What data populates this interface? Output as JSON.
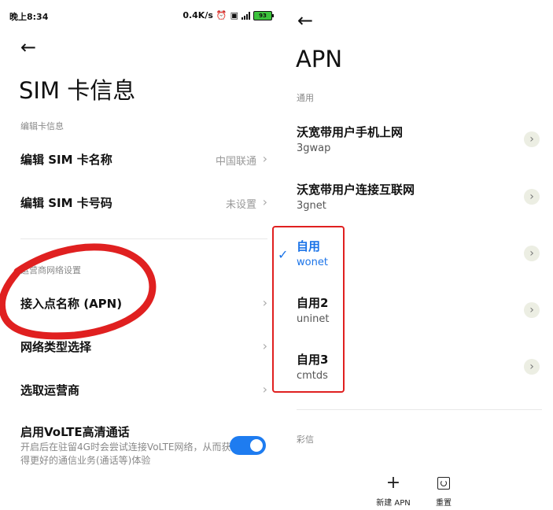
{
  "status_bar": {
    "time": "晚上8:34",
    "net_speed": "0.4K/s",
    "battery": "93"
  },
  "sim_info": {
    "title": "SIM 卡信息",
    "section_edit": "编辑卡信息",
    "edit_name_label": "编辑 SIM 卡名称",
    "edit_name_value": "中国联通",
    "edit_number_label": "编辑 SIM 卡号码",
    "edit_number_value": "未设置",
    "section_carrier": "运营商网络设置",
    "apn_label": "接入点名称 (APN)",
    "network_type_label": "网络类型选择",
    "carrier_select_label": "选取运营商",
    "volte_title": "启用VoLTE高清通话",
    "volte_desc": "开启后在驻留4G时会尝试连接VoLTE网络，从而获得更好的通信业务(通话等)体验",
    "volte_enabled": true
  },
  "apn": {
    "title": "APN",
    "section_general": "通用",
    "items": [
      {
        "name": "沃宽带用户手机上网",
        "type": "3gwap",
        "selected": false
      },
      {
        "name": "沃宽带用户连接互联网",
        "type": "3gnet",
        "selected": false
      },
      {
        "name": "自用",
        "type": "wonet",
        "selected": true
      },
      {
        "name": "自用2",
        "type": "uninet",
        "selected": false
      },
      {
        "name": "自用3",
        "type": "cmtds",
        "selected": false
      }
    ],
    "section_mms": "彩信",
    "new_apn_label": "新建 APN",
    "reset_label": "重置"
  },
  "icons": {
    "back": "arrow-left-icon",
    "chevron": "chevron-right-icon",
    "check": "check-icon",
    "add": "plus-icon",
    "reset": "reset-icon"
  },
  "colors": {
    "accent": "#1e7cf0",
    "annotation_red": "#e02020",
    "muted_text": "#888888"
  }
}
